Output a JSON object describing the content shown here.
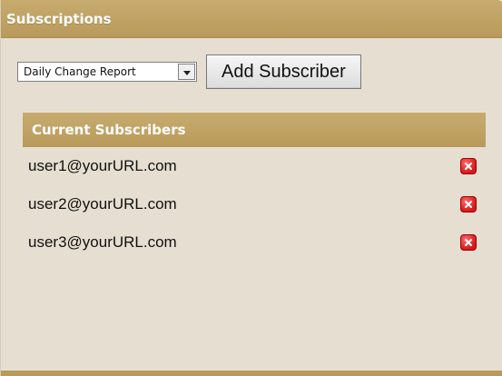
{
  "panel": {
    "title": "Subscriptions"
  },
  "controls": {
    "report_select": {
      "selected": "Daily Change Report"
    },
    "add_button_label": "Add Subscriber"
  },
  "subscribers": {
    "title": "Current Subscribers",
    "items": [
      {
        "email": "user1@yourURL.com",
        "remove_icon": "remove-x-icon"
      },
      {
        "email": "user2@yourURL.com",
        "remove_icon": "remove-x-icon"
      },
      {
        "email": "user3@yourURL.com",
        "remove_icon": "remove-x-icon"
      }
    ]
  },
  "colors": {
    "header": "#BFA263",
    "background": "#E6DFD1",
    "remove": "#D31B1B"
  }
}
